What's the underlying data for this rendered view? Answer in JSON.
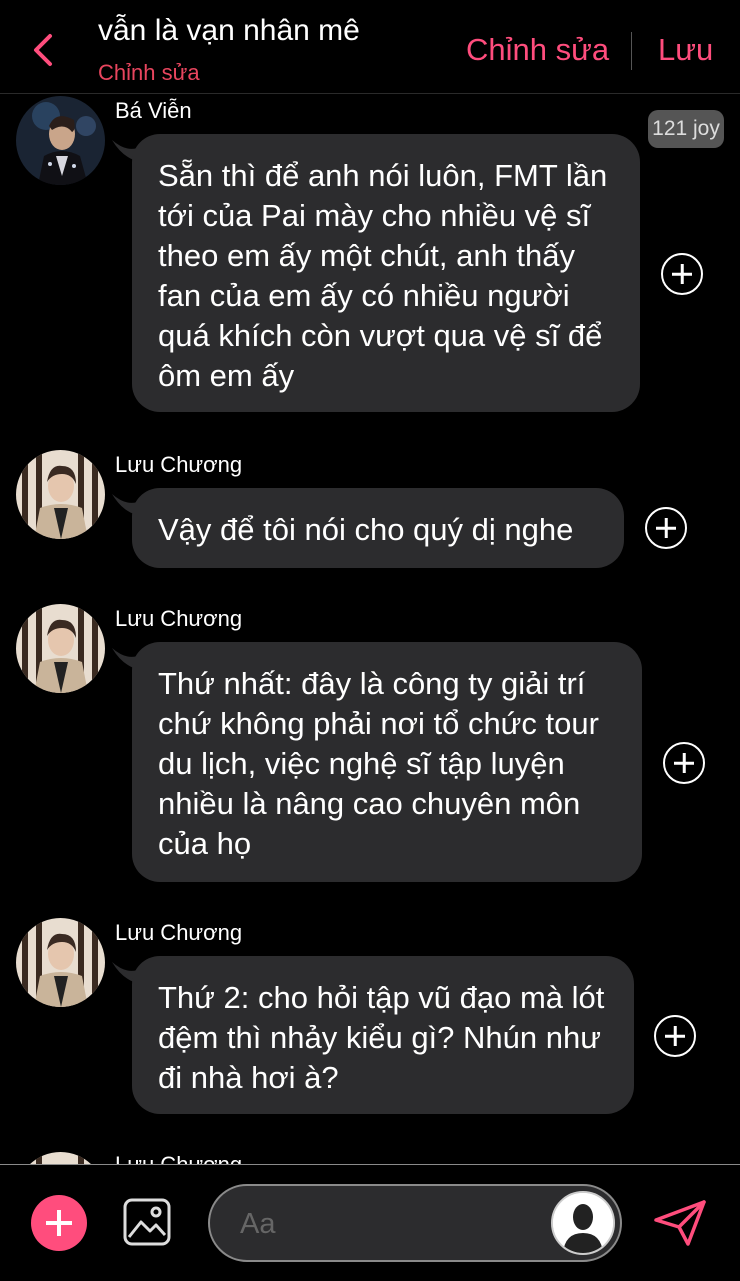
{
  "header": {
    "title": "vẫn là vạn nhân mê",
    "subtitle": "Chỉnh sửa",
    "edit_label": "Chỉnh sửa",
    "save_label": "Lưu"
  },
  "badge": "121 joy",
  "messages": [
    {
      "sender": "Bá Viễn",
      "text": "Sẵn thì để anh nói luôn, FMT lần tới của Pai mày cho nhiều vệ sĩ theo em ấy một chút, anh thấy fan của em ấy có nhiều người quá khích còn vượt qua vệ sĩ để ôm em ấy"
    },
    {
      "sender": "Lưu Chương",
      "text": "Vậy để tôi nói cho quý dị nghe"
    },
    {
      "sender": "Lưu Chương",
      "text": "Thứ nhất: đây là công ty giải trí chứ không phải nơi tổ chức tour du lịch, việc nghệ sĩ tập luyện nhiều là nâng cao chuyên môn của họ"
    },
    {
      "sender": "Lưu Chương",
      "text": "Thứ 2: cho hỏi tập vũ đạo mà lót đệm thì nhảy kiểu gì? Nhún như đi nhà hơi à?"
    },
    {
      "sender": "Lưu Chương",
      "text": ""
    }
  ],
  "composer": {
    "placeholder": "Aa"
  },
  "colors": {
    "accent": "#ff4d7d",
    "subtitle": "#e8455e",
    "bubble": "#2c2c2e",
    "background": "#000000"
  }
}
